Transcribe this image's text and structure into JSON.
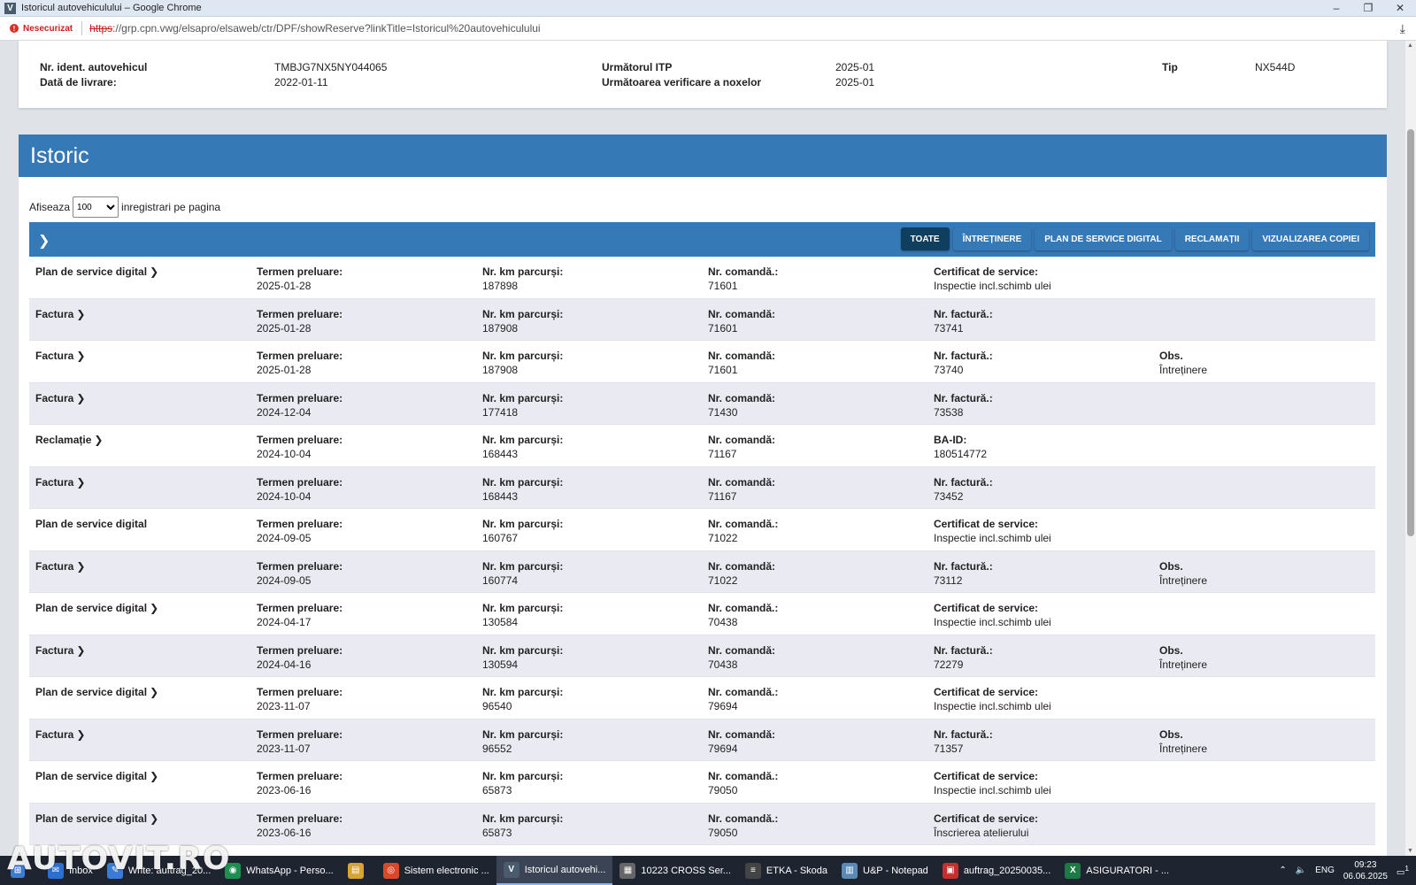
{
  "window": {
    "title": "Istoricul autovehiculului – Google Chrome",
    "app_icon": "V",
    "minimize": "–",
    "maximize": "❐",
    "close": "✕"
  },
  "address": {
    "security_label": "Nesecurizat",
    "url_protocol": "https",
    "url_rest": "://grp.cpn.vwg/elsapro/elsaweb/ctr/DPF/showReserve?linkTitle=Istoricul%20autovehiculului"
  },
  "vehicle": {
    "vin_label": "Nr. ident. autovehicul",
    "vin_value": "TMBJG7NX5NY044065",
    "delivery_label": "Dată de livrare:",
    "delivery_value": "2022-01-11",
    "itp_label": "Următorul ITP",
    "itp_value": "2025-01",
    "noxe_label": "Următoarea verificare a noxelor",
    "noxe_value": "2025-01",
    "type_label": "Tip",
    "type_value": "NX544D"
  },
  "history": {
    "title": "Istoric",
    "show_label": "Afiseaza",
    "per_page_value": "100",
    "per_page_suffix": "inregistrari pe pagina",
    "toggle_icon": "❯",
    "filters": [
      {
        "label": "TOATE",
        "active": true
      },
      {
        "label": "ÎNTREȚINERE",
        "active": false
      },
      {
        "label": "PLAN DE SERVICE DIGITAL",
        "active": false
      },
      {
        "label": "RECLAMAȚII",
        "active": false
      },
      {
        "label": "VIZUALIZAREA COPIEI",
        "active": false
      }
    ],
    "rows": [
      {
        "type": "Plan de service digital",
        "chev": "❯",
        "date_k": "Termen preluare:",
        "date_v": "2025-01-28",
        "km_k": "Nr. km parcurși:",
        "km_v": "187898",
        "order_k": "Nr. comandă.:",
        "order_v": "71601",
        "d_k": "Certificat de service:",
        "d_v": "Inspectie incl.schimb ulei",
        "obs_k": "",
        "obs_v": ""
      },
      {
        "type": "Factura",
        "chev": "❯",
        "date_k": "Termen preluare:",
        "date_v": "2025-01-28",
        "km_k": "Nr. km parcurși:",
        "km_v": "187908",
        "order_k": "Nr. comandă:",
        "order_v": "71601",
        "d_k": "Nr. factură.:",
        "d_v": "73741",
        "obs_k": "",
        "obs_v": ""
      },
      {
        "type": "Factura",
        "chev": "❯",
        "date_k": "Termen preluare:",
        "date_v": "2025-01-28",
        "km_k": "Nr. km parcurși:",
        "km_v": "187908",
        "order_k": "Nr. comandă:",
        "order_v": "71601",
        "d_k": "Nr. factură.:",
        "d_v": "73740",
        "obs_k": "Obs.",
        "obs_v": "Întreținere"
      },
      {
        "type": "Factura",
        "chev": "❯",
        "date_k": "Termen preluare:",
        "date_v": "2024-12-04",
        "km_k": "Nr. km parcurși:",
        "km_v": "177418",
        "order_k": "Nr. comandă:",
        "order_v": "71430",
        "d_k": "Nr. factură.:",
        "d_v": "73538",
        "obs_k": "",
        "obs_v": ""
      },
      {
        "type": "Reclamație",
        "chev": "❯",
        "date_k": "Termen preluare:",
        "date_v": "2024-10-04",
        "km_k": "Nr. km parcurși:",
        "km_v": "168443",
        "order_k": "Nr. comandă:",
        "order_v": "71167",
        "d_k": "BA-ID:",
        "d_v": "180514772",
        "obs_k": "",
        "obs_v": ""
      },
      {
        "type": "Factura",
        "chev": "❯",
        "date_k": "Termen preluare:",
        "date_v": "2024-10-04",
        "km_k": "Nr. km parcurși:",
        "km_v": "168443",
        "order_k": "Nr. comandă:",
        "order_v": "71167",
        "d_k": "Nr. factură.:",
        "d_v": "73452",
        "obs_k": "",
        "obs_v": ""
      },
      {
        "type": "Plan de service digital",
        "chev": "",
        "date_k": "Termen preluare:",
        "date_v": "2024-09-05",
        "km_k": "Nr. km parcurși:",
        "km_v": "160767",
        "order_k": "Nr. comandă.:",
        "order_v": "71022",
        "d_k": "Certificat de service:",
        "d_v": "Inspectie incl.schimb ulei",
        "obs_k": "",
        "obs_v": ""
      },
      {
        "type": "Factura",
        "chev": "❯",
        "date_k": "Termen preluare:",
        "date_v": "2024-09-05",
        "km_k": "Nr. km parcurși:",
        "km_v": "160774",
        "order_k": "Nr. comandă:",
        "order_v": "71022",
        "d_k": "Nr. factură.:",
        "d_v": "73112",
        "obs_k": "Obs.",
        "obs_v": "Întreținere"
      },
      {
        "type": "Plan de service digital",
        "chev": "❯",
        "date_k": "Termen preluare:",
        "date_v": "2024-04-17",
        "km_k": "Nr. km parcurși:",
        "km_v": "130584",
        "order_k": "Nr. comandă.:",
        "order_v": "70438",
        "d_k": "Certificat de service:",
        "d_v": "Inspectie incl.schimb ulei",
        "obs_k": "",
        "obs_v": ""
      },
      {
        "type": "Factura",
        "chev": "❯",
        "date_k": "Termen preluare:",
        "date_v": "2024-04-16",
        "km_k": "Nr. km parcurși:",
        "km_v": "130594",
        "order_k": "Nr. comandă:",
        "order_v": "70438",
        "d_k": "Nr. factură.:",
        "d_v": "72279",
        "obs_k": "Obs.",
        "obs_v": "Întreținere"
      },
      {
        "type": "Plan de service digital",
        "chev": "❯",
        "date_k": "Termen preluare:",
        "date_v": "2023-11-07",
        "km_k": "Nr. km parcurși:",
        "km_v": "96540",
        "order_k": "Nr. comandă.:",
        "order_v": "79694",
        "d_k": "Certificat de service:",
        "d_v": "Inspectie incl.schimb ulei",
        "obs_k": "",
        "obs_v": ""
      },
      {
        "type": "Factura",
        "chev": "❯",
        "date_k": "Termen preluare:",
        "date_v": "2023-11-07",
        "km_k": "Nr. km parcurși:",
        "km_v": "96552",
        "order_k": "Nr. comandă:",
        "order_v": "79694",
        "d_k": "Nr. factură.:",
        "d_v": "71357",
        "obs_k": "Obs.",
        "obs_v": "Întreținere"
      },
      {
        "type": "Plan de service digital",
        "chev": "❯",
        "date_k": "Termen preluare:",
        "date_v": "2023-06-16",
        "km_k": "Nr. km parcurși:",
        "km_v": "65873",
        "order_k": "Nr. comandă.:",
        "order_v": "79050",
        "d_k": "Certificat de service:",
        "d_v": "Inspectie incl.schimb ulei",
        "obs_k": "",
        "obs_v": ""
      },
      {
        "type": "Plan de service digital",
        "chev": "❯",
        "date_k": "Termen preluare:",
        "date_v": "2023-06-16",
        "km_k": "Nr. km parcurși:",
        "km_v": "65873",
        "order_k": "Nr. comandă.:",
        "order_v": "79050",
        "d_k": "Certificat de service:",
        "d_v": "Înscrierea atelierului",
        "obs_k": "",
        "obs_v": ""
      }
    ]
  },
  "taskbar": {
    "items": [
      {
        "label": "Inbox",
        "icon": "✉",
        "color": "#2b6fd1"
      },
      {
        "label": "Write: auftrag_20...",
        "icon": "✎",
        "color": "#3a7bd5"
      },
      {
        "label": "WhatsApp - Perso...",
        "icon": "◉",
        "color": "#1d8f4e"
      },
      {
        "label": "",
        "icon": "▤",
        "color": "#d6a531"
      },
      {
        "label": "Sistem electronic ...",
        "icon": "◎",
        "color": "#d9482b"
      },
      {
        "label": "Istoricul autovehi...",
        "icon": "V",
        "color": "#4a5b6e"
      },
      {
        "label": "10223 CROSS Ser...",
        "icon": "▦",
        "color": "#666"
      },
      {
        "label": "ETKA - Skoda",
        "icon": "≡",
        "color": "#444"
      },
      {
        "label": "U&P - Notepad",
        "icon": "▥",
        "color": "#5b8bb5"
      },
      {
        "label": "auftrag_20250035...",
        "icon": "▣",
        "color": "#c4302b"
      },
      {
        "label": "ASIGURATORI - ...",
        "icon": "X",
        "color": "#1d7a45"
      }
    ],
    "lang": "ENG",
    "time": "09:23",
    "date": "06.06.2025",
    "notif_count": "1"
  },
  "watermark": "AUTOVIT.RO"
}
